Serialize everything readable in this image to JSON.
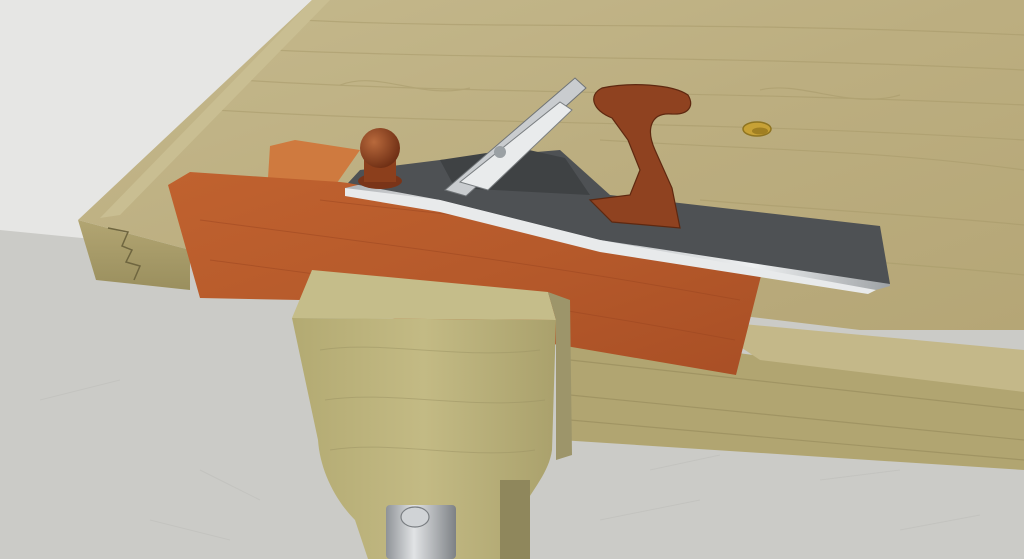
{
  "scene": {
    "subject": "",
    "colors": {
      "floor": "#c9c9c6",
      "wall": "#e4e4e2",
      "bench_top": "#bfb184",
      "bench_edge": "#a99e6c",
      "bench_dark": "#8c8355",
      "cherry": "#b7592c",
      "cherry_light": "#c9743b",
      "steel": "#d7d9db",
      "steel_dark": "#505356",
      "tote": "#8b3f1f",
      "dog_hole": "#c7a136",
      "vise_chop": "#bdb47c",
      "vise_chop_shade": "#9d956a",
      "screw_metal": "#b9bcbf"
    },
    "icons": [
      "bench-dog-hole-icon",
      "vise-screw-icon",
      "plane-knob-icon",
      "plane-tote-icon"
    ]
  }
}
